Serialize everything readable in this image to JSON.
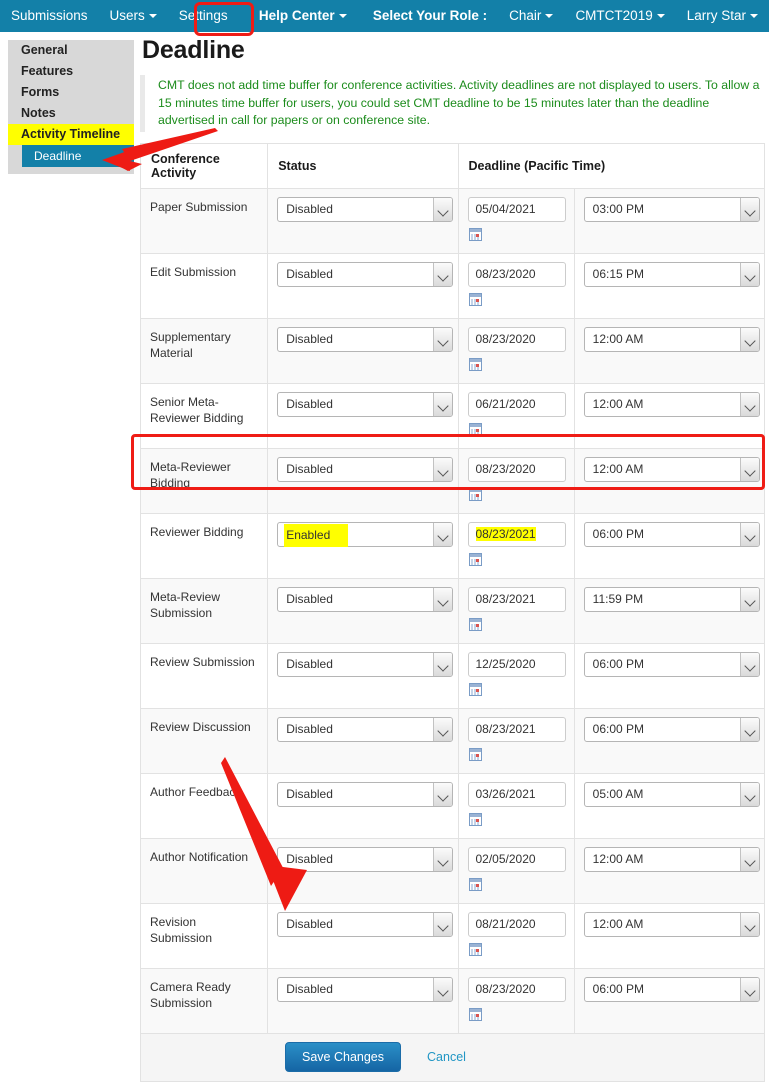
{
  "topnav": {
    "items": [
      {
        "label": "Submissions",
        "caret": false,
        "bold": false
      },
      {
        "label": "Users",
        "caret": true,
        "bold": false
      },
      {
        "label": "Settings",
        "caret": false,
        "bold": false
      },
      {
        "label": "Help Center",
        "caret": true,
        "bold": true
      },
      {
        "label": "Select Your Role :",
        "caret": false,
        "bold": true
      },
      {
        "label": "Chair",
        "caret": true,
        "bold": false
      },
      {
        "label": "CMTCT2019",
        "caret": true,
        "bold": false
      },
      {
        "label": "Larry Star",
        "caret": true,
        "bold": false
      }
    ],
    "background_color": "#1380a8"
  },
  "sidebar": {
    "items": [
      {
        "label": "General",
        "highlighted": false
      },
      {
        "label": "Features",
        "highlighted": false
      },
      {
        "label": "Forms",
        "highlighted": false
      },
      {
        "label": "Notes",
        "highlighted": false
      },
      {
        "label": "Activity Timeline",
        "highlighted": true
      }
    ],
    "selected_sub_item": "Deadline",
    "highlight_color": "#ffff00",
    "selected_color": "#1380a8"
  },
  "main": {
    "title": "Deadline",
    "info_note": "CMT does not add time buffer for conference activities. Activity deadlines are not displayed to users. To allow a 15 minutes time buffer for users, you could set CMT deadline to be 15 minutes later than the deadline advertised in call for papers or on conference site.",
    "info_note_color": "#1c8c1c"
  },
  "table": {
    "headers": [
      "Conference Activity",
      "Status",
      "Deadline (Pacific Time)"
    ],
    "rows": [
      {
        "activity": "Paper Submission",
        "status": "Disabled",
        "date": "05/04/2021",
        "time": "03:00 PM",
        "highlight": false
      },
      {
        "activity": "Edit Submission",
        "status": "Disabled",
        "date": "08/23/2020",
        "time": "06:15 PM",
        "highlight": false
      },
      {
        "activity": "Supplementary Material",
        "status": "Disabled",
        "date": "08/23/2020",
        "time": "12:00 AM",
        "highlight": false
      },
      {
        "activity": "Senior Meta-Reviewer Bidding",
        "status": "Disabled",
        "date": "06/21/2020",
        "time": "12:00 AM",
        "highlight": false
      },
      {
        "activity": "Meta-Reviewer Bidding",
        "status": "Disabled",
        "date": "08/23/2020",
        "time": "12:00 AM",
        "highlight": false
      },
      {
        "activity": "Reviewer Bidding",
        "status": "Enabled",
        "date": "08/23/2021",
        "time": "06:00 PM",
        "highlight": true
      },
      {
        "activity": "Meta-Review Submission",
        "status": "Disabled",
        "date": "08/23/2021",
        "time": "11:59 PM",
        "highlight": false
      },
      {
        "activity": "Review Submission",
        "status": "Disabled",
        "date": "12/25/2020",
        "time": "06:00 PM",
        "highlight": false
      },
      {
        "activity": "Review Discussion",
        "status": "Disabled",
        "date": "08/23/2021",
        "time": "06:00 PM",
        "highlight": false
      },
      {
        "activity": "Author Feedback",
        "status": "Disabled",
        "date": "03/26/2021",
        "time": "05:00 AM",
        "highlight": false
      },
      {
        "activity": "Author Notification",
        "status": "Disabled",
        "date": "02/05/2020",
        "time": "12:00 AM",
        "highlight": false
      },
      {
        "activity": "Revision Submission",
        "status": "Disabled",
        "date": "08/21/2020",
        "time": "12:00 AM",
        "highlight": false
      },
      {
        "activity": "Camera Ready Submission",
        "status": "Disabled",
        "date": "08/23/2020",
        "time": "06:00 PM",
        "highlight": false
      }
    ]
  },
  "footer": {
    "save_label": "Save Changes",
    "cancel_label": "Cancel"
  },
  "annotations": {
    "color": "#ef1c15",
    "settings_box": "red box around Settings nav item",
    "row_box": "red box around Reviewer Bidding row",
    "arrow_sidebar": "red arrow pointing to Deadline sidebar item",
    "arrow_save": "red arrow pointing to Save Changes button"
  }
}
